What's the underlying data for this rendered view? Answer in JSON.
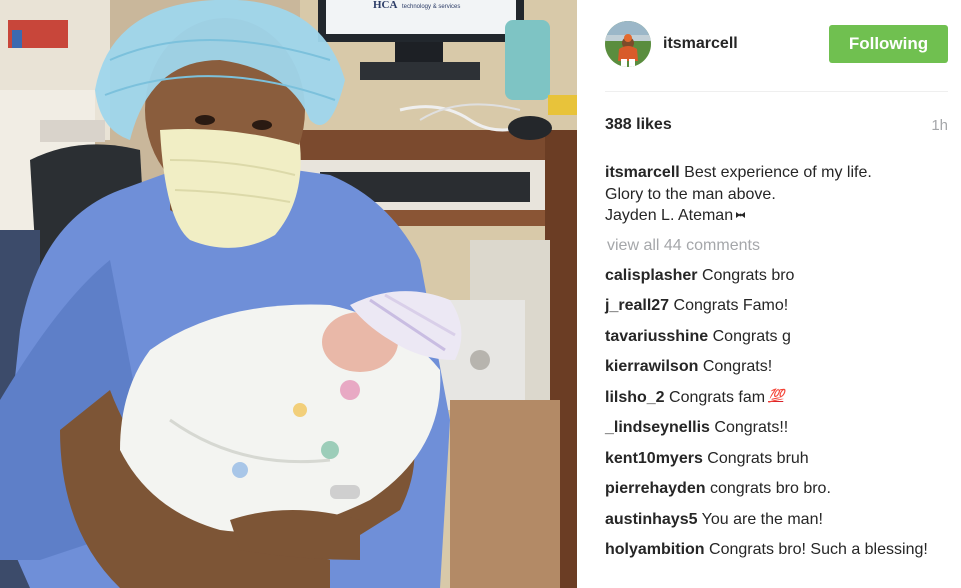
{
  "post": {
    "username": "itsmarcell",
    "follow_label": "Following",
    "likes": "388 likes",
    "time": "1h",
    "caption": {
      "user": "itsmarcell",
      "lines": [
        "Best experience of my life.",
        "Glory to the man above.",
        "Jayden L. Ateman"
      ],
      "trailing_icon": "bow-tie-icon"
    },
    "view_all": "view all 44 comments",
    "comments": [
      {
        "user": "calisplasher",
        "text": "Congrats bro"
      },
      {
        "user": "j_reall27",
        "text": "Congrats Famo!"
      },
      {
        "user": "tavariusshine",
        "text": "Congrats g"
      },
      {
        "user": "kierrawilson",
        "text": "Congrats!"
      },
      {
        "user": "lilsho_2",
        "text": "Congrats fam",
        "emoji": "💯"
      },
      {
        "user": "_lindseynellis",
        "text": "Congrats!!"
      },
      {
        "user": "kent10myers",
        "text": "Congrats bruh"
      },
      {
        "user": "pierrehayden",
        "text": "congrats bro bro."
      },
      {
        "user": "austinhays5",
        "text": "You are the man!"
      },
      {
        "user": "holyambition",
        "text": "Congrats bro! Such a blessing!"
      }
    ],
    "photo": {
      "monitor_brand": "HCA",
      "monitor_tagline": "technology & services"
    }
  },
  "colors": {
    "follow_button": "#70c050",
    "text": "#262626",
    "muted": "#a5a7aa",
    "divider": "#efefef"
  }
}
